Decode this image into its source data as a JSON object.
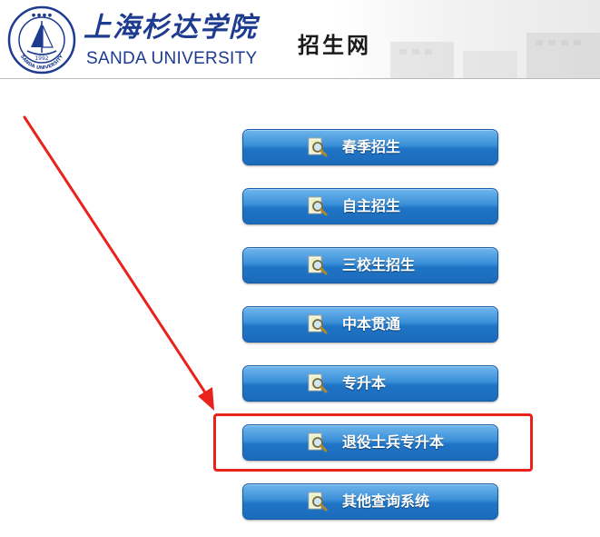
{
  "header": {
    "seal_year": "1992",
    "seal_ring_text": "SANDA UNIVERSITY",
    "university_name_cn": "上海杉达学院",
    "university_name_en": "SANDA UNIVERSITY",
    "site_title": "招生网"
  },
  "menu": {
    "items": [
      {
        "label": "春季招生"
      },
      {
        "label": "自主招生"
      },
      {
        "label": "三校生招生"
      },
      {
        "label": "中本贯通"
      },
      {
        "label": "专升本"
      },
      {
        "label": "退役士兵专升本"
      },
      {
        "label": "其他查询系统"
      }
    ],
    "highlighted_index": 5
  },
  "colors": {
    "button_top": "#6fb6ec",
    "button_bottom": "#1c6bbb",
    "annotation_red": "#e8231c",
    "brand_blue": "#1d3b8f"
  },
  "icons": {
    "menu_icon": "document-magnifier-icon"
  }
}
